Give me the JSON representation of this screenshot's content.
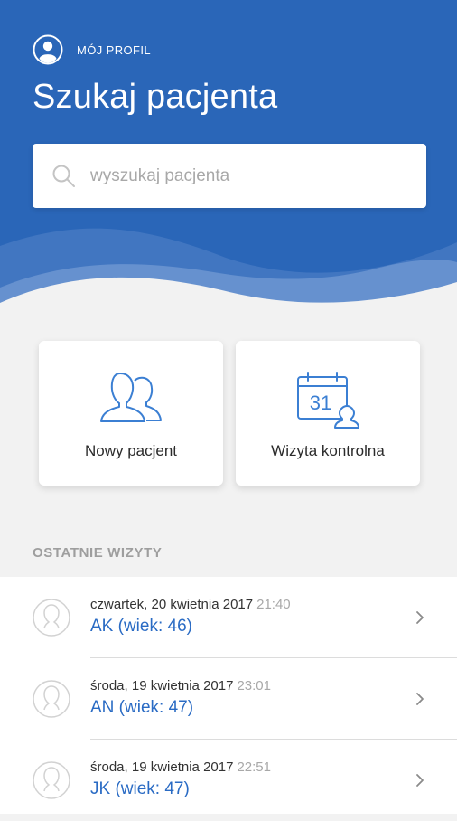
{
  "header": {
    "profile_label": "MÓJ PROFIL",
    "title": "Szukaj pacjenta",
    "background_color": "#2a66b8"
  },
  "search": {
    "placeholder": "wyszukaj pacjenta",
    "value": ""
  },
  "actions": {
    "new_patient_label": "Nowy pacjent",
    "control_visit_label": "Wizyta kontrolna",
    "calendar_day": "31"
  },
  "recent": {
    "section_title": "OSTATNIE WIZYTY",
    "items": [
      {
        "date": "czwartek, 20 kwietnia 2017",
        "time": "21:40",
        "patient": "AK (wiek: 46)"
      },
      {
        "date": "środa, 19 kwietnia 2017",
        "time": "23:01",
        "patient": "AN (wiek: 47)"
      },
      {
        "date": "środa, 19 kwietnia 2017",
        "time": "22:51",
        "patient": "JK (wiek: 47)"
      }
    ]
  },
  "colors": {
    "accent": "#2a6bc4",
    "icon_blue": "#3b7fd3",
    "page_background": "#f2f2f2"
  }
}
